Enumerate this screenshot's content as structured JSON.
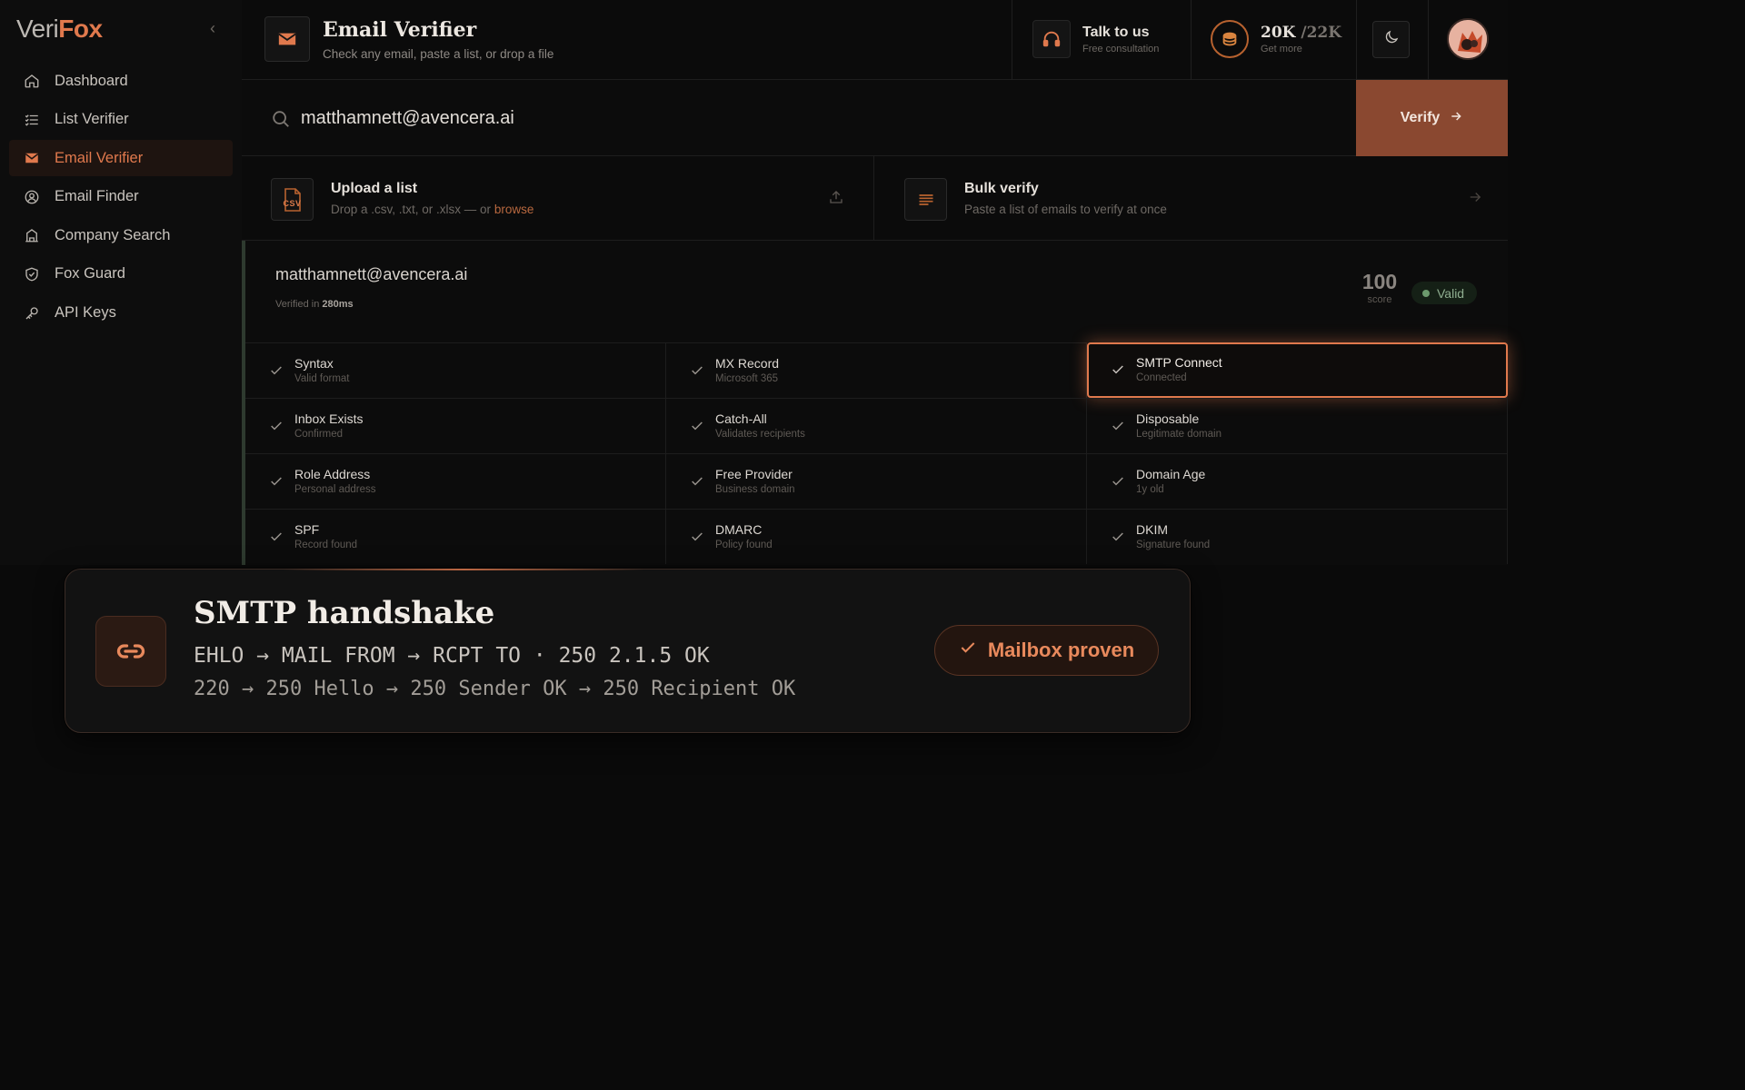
{
  "brand": {
    "part1": "Veri",
    "part2": "Fox"
  },
  "sidebar": {
    "items": [
      {
        "label": "Dashboard",
        "icon": "home-icon"
      },
      {
        "label": "List Verifier",
        "icon": "list-icon"
      },
      {
        "label": "Email Verifier",
        "icon": "mail-icon",
        "active": true
      },
      {
        "label": "Email Finder",
        "icon": "user-search-icon"
      },
      {
        "label": "Company Search",
        "icon": "building-icon"
      },
      {
        "label": "Fox Guard",
        "icon": "shield-check-icon"
      },
      {
        "label": "API Keys",
        "icon": "key-icon"
      }
    ]
  },
  "header": {
    "title": "Email Verifier",
    "subtitle": "Check any email, paste a list, or drop a file",
    "talk": {
      "title": "Talk to us",
      "subtitle": "Free consultation"
    },
    "credits": {
      "used": "20K",
      "total": "/22K",
      "subtitle": "Get more"
    }
  },
  "search": {
    "value": "matthamnett@avencera.ai",
    "button": "Verify"
  },
  "actions": {
    "upload": {
      "title": "Upload a list",
      "desc_prefix": "Drop a .csv, .txt, or .xlsx — or",
      "link": "browse",
      "icon_text": "CSV"
    },
    "bulk": {
      "title": "Bulk verify",
      "desc": "Paste a list of emails to verify at once"
    }
  },
  "result": {
    "email": "matthamnett@avencera.ai",
    "verified_prefix": "Verified in",
    "verified_time": "280ms",
    "score": "100",
    "score_label": "score",
    "status": "Valid",
    "checks": [
      {
        "title": "Syntax",
        "desc": "Valid format"
      },
      {
        "title": "MX Record",
        "desc": "Microsoft 365"
      },
      {
        "title": "SMTP Connect",
        "desc": "Connected",
        "highlight": true
      },
      {
        "title": "Inbox Exists",
        "desc": "Confirmed"
      },
      {
        "title": "Catch-All",
        "desc": "Validates recipients"
      },
      {
        "title": "Disposable",
        "desc": "Legitimate domain"
      },
      {
        "title": "Role Address",
        "desc": "Personal address"
      },
      {
        "title": "Free Provider",
        "desc": "Business domain"
      },
      {
        "title": "Domain Age",
        "desc": "1y old"
      },
      {
        "title": "SPF",
        "desc": "Record found"
      },
      {
        "title": "DMARC",
        "desc": "Policy found"
      },
      {
        "title": "DKIM",
        "desc": "Signature found"
      }
    ]
  },
  "overlay": {
    "title": "SMTP handshake",
    "line1": "EHLO → MAIL FROM → RCPT TO · 250 2.1.5 OK",
    "line2": "220 → 250 Hello → 250 Sender OK → 250 Recipient OK",
    "badge": "Mailbox proven",
    "icon": "link-icon"
  },
  "colors": {
    "accent": "#e0794d",
    "accent_dark": "#8a4830",
    "valid": "#6c9a6d",
    "bg": "#0a0a0a"
  }
}
